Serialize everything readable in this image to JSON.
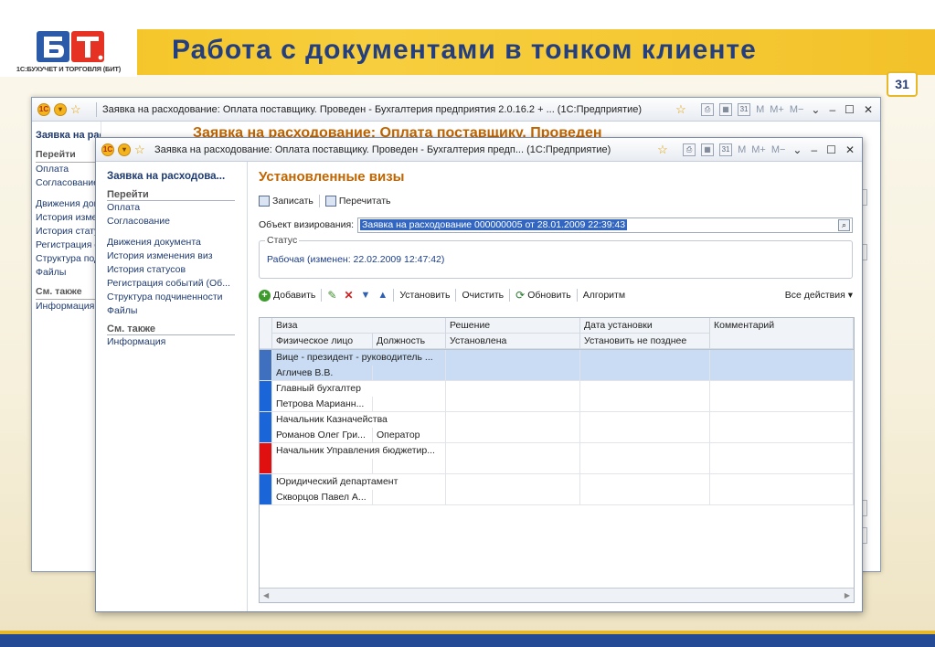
{
  "slide": {
    "title": "Работа с документами в тонком клиенте",
    "page_number": "31",
    "logo_caption": "1С:БУХУЧЕТ И ТОРГОВЛЯ (БИТ)",
    "colors": {
      "header": "#f4c220",
      "title": "#243f7f",
      "bottom": "#244a96"
    }
  },
  "back_window": {
    "title": "Заявка на расходование: Оплата поставщику. Проведен - Бухгалтерия предприятия 2.0.16.2 + ...  (1С:Предприятие)",
    "heading": "Заявка на расходование: Оплата поставщику. Проведен",
    "side_title": "Заявка на расходова",
    "side_goto": "Перейти",
    "side_items": [
      "Оплата",
      "Согласование",
      "Движения документа",
      "История изменения виз",
      "История статусов",
      "Регистрация событий",
      "Структура подчиненности",
      "Файлы"
    ],
    "side_also": "См. также",
    "side_info": "Информация",
    "tools": {
      "m": "M",
      "mplus": "M+",
      "mminus": "M−",
      "dropdown": "⌄",
      "minimize": "–",
      "maximize": "☐",
      "close": "✕"
    }
  },
  "front_window": {
    "title": "Заявка на расходование: Оплата поставщику. Проведен - Бухгалтерия предп...  (1С:Предприятие)",
    "tools": {
      "m": "M",
      "mplus": "M+",
      "mminus": "M−",
      "dropdown": "⌄",
      "minimize": "–",
      "maximize": "☐",
      "close": "✕"
    },
    "sidebar": {
      "title": "Заявка на расходова...",
      "goto_label": "Перейти",
      "goto_items": [
        "Оплата",
        "Согласование"
      ],
      "items": [
        "Движения документа",
        "История изменения виз",
        "История статусов",
        "Регистрация событий (Об...",
        "Структура подчиненности",
        "Файлы"
      ],
      "also_label": "См. также",
      "also_items": [
        "Информация"
      ]
    },
    "heading": "Установленные визы",
    "toolbar": {
      "save": "Записать",
      "reread": "Перечитать"
    },
    "object": {
      "label": "Объект визирования:",
      "value": "Заявка на расходование 000000005 от 28.01.2009 22:39:43"
    },
    "status": {
      "legend": "Статус",
      "text": "Рабочая (изменен: 22.02.2009 12:47:42)"
    },
    "grid_toolbar": {
      "add": "Добавить",
      "set": "Установить",
      "clear": "Очистить",
      "refresh": "Обновить",
      "algorithm": "Алгоритм",
      "all_actions": "Все действия ▾"
    },
    "grid": {
      "head1": [
        "Виза",
        "Решение",
        "Дата установки",
        "Комментарий"
      ],
      "head2": [
        "Физическое лицо",
        "Должность",
        "Установлена",
        "Установить не позднее"
      ],
      "rows": [
        {
          "visa": "Вице - президент - руководитель ...",
          "person": "Агличев В.В.",
          "position": "",
          "marker": "#3f6fbf",
          "selected": true
        },
        {
          "visa": "Главный бухгалтер",
          "person": "Петрова Марианн...",
          "position": "",
          "marker": "#1a66d8",
          "selected": false
        },
        {
          "visa": "Начальник Казначейства",
          "person": "Романов Олег Гри...",
          "position": "Оператор",
          "marker": "#1a66d8",
          "selected": false
        },
        {
          "visa": "Начальник Управления бюджетир...",
          "person": "",
          "position": "",
          "marker": "#e01010",
          "selected": false
        },
        {
          "visa": "Юридический департамент",
          "person": "Скворцов Павел А...",
          "position": "",
          "marker": "#1a66d8",
          "selected": false
        }
      ]
    }
  }
}
